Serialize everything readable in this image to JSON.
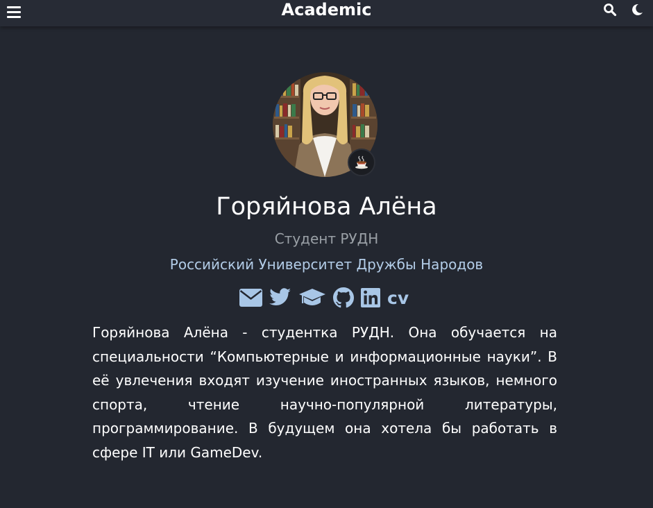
{
  "navbar": {
    "brand": "Academic",
    "menu_icon": "hamburger-menu-icon",
    "search_icon": "search-icon",
    "theme_icon": "moon-icon"
  },
  "profile": {
    "name": "Горяйнова Алёна",
    "role": "Студент РУДН",
    "organization": "Российский Университет Дружбы Народов",
    "status_emoji": "☕",
    "social": [
      {
        "icon": "envelope-icon"
      },
      {
        "icon": "twitter-icon"
      },
      {
        "icon": "graduation-cap-icon"
      },
      {
        "icon": "github-icon"
      },
      {
        "icon": "linkedin-icon"
      },
      {
        "icon": "cv-icon",
        "label": "cv"
      }
    ],
    "bio": "Горяйнова Алёна - студентка РУДН. Она обучается на специальности “Компьютерные и информационные науки”. В её увлечения входят изучение иностранных языков, немного спорта, чтение научно-популярной литературы, программирование. В будущем она хотела бы работать в сфере IT или GameDev."
  },
  "colors": {
    "background": "#232730",
    "navbar": "#272b35",
    "accent": "#a8c6e6",
    "muted": "#9aa0a6"
  }
}
